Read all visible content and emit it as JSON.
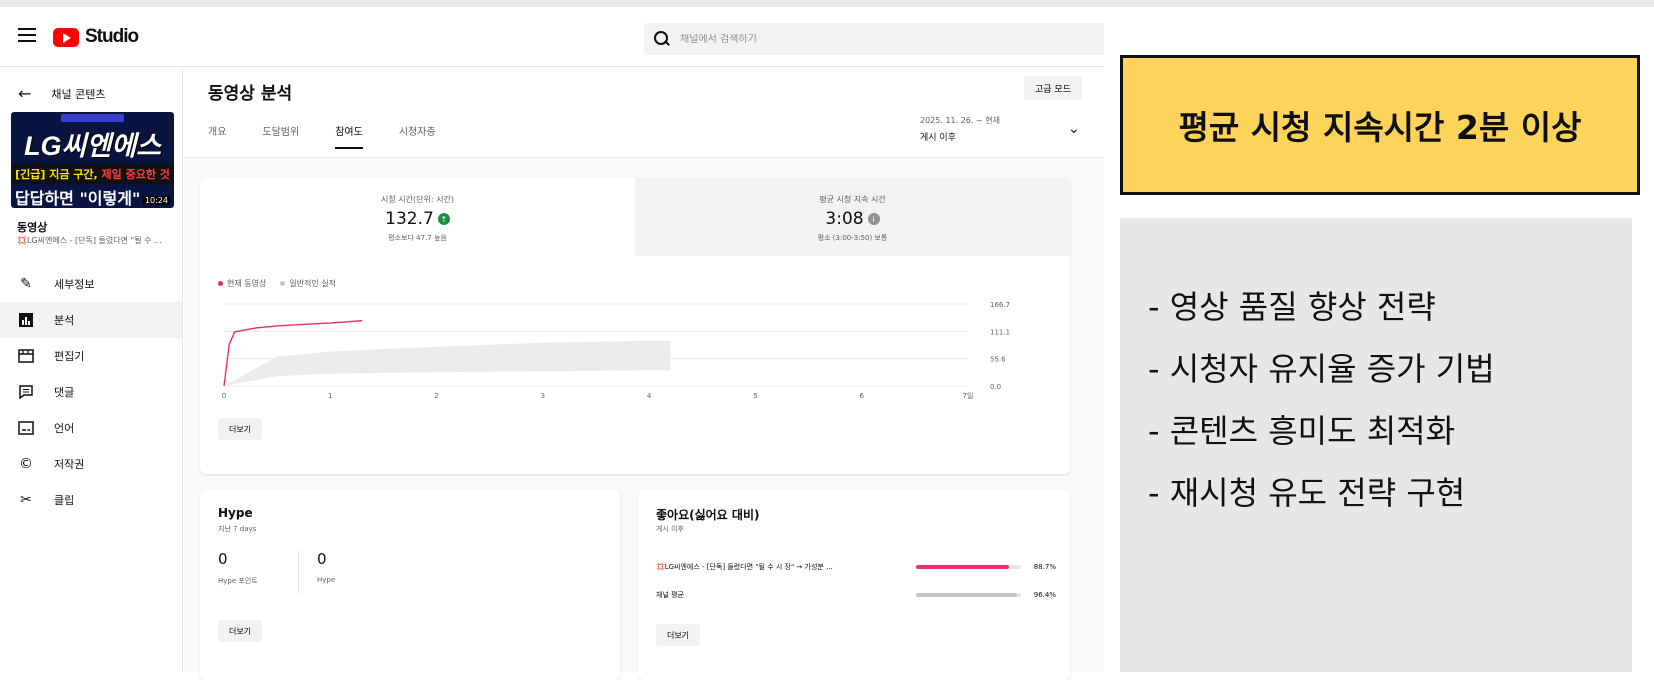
{
  "app": {
    "name": "Studio"
  },
  "search": {
    "placeholder": "채널에서 검색하기"
  },
  "sidebar": {
    "back_label": "채널 콘텐츠",
    "thumb": {
      "title": "LG씨엔에스",
      "line2_highlight": "[긴급]",
      "line2_a": " 지금 구간, ",
      "line2_red": "제일 중요한 것",
      "line3": "답답하면 \"이렇게\"",
      "duration": "10:24"
    },
    "video_label": "동영상",
    "video_title": "💢LG씨엔에스 - [단독] 들렸다면 \"될 수 ...",
    "items": [
      {
        "label": "세부정보",
        "icon": "pencil-icon"
      },
      {
        "label": "분석",
        "icon": "analytics-icon"
      },
      {
        "label": "편집기",
        "icon": "editor-icon"
      },
      {
        "label": "댓글",
        "icon": "comment-icon"
      },
      {
        "label": "언어",
        "icon": "subtitles-icon"
      },
      {
        "label": "저작권",
        "icon": "copyright-icon"
      },
      {
        "label": "클립",
        "icon": "scissors-icon"
      }
    ]
  },
  "header": {
    "title": "동영상 분석",
    "advanced_mode": "고급 모드",
    "tabs": [
      "개요",
      "도달범위",
      "참여도",
      "시청자층"
    ],
    "active_tab": 2,
    "date_range_line1": "2025. 11. 26. ~ 현재",
    "date_range_line2": "게시 이후"
  },
  "metrics": [
    {
      "label": "시청 시간(단위: 시간)",
      "value": "132.7",
      "sub": "평소보다 47.7 높음",
      "status": "up"
    },
    {
      "label": "평균 시청 지속 시간",
      "value": "3:08",
      "sub": "평소 (3:00-3:50) 보통",
      "status": "info"
    }
  ],
  "legend": [
    {
      "label": "현재 동영상",
      "color": "#e8306b"
    },
    {
      "label": "일반적인 실적",
      "color": "#c4c4c4"
    }
  ],
  "chart_data": {
    "type": "line",
    "x_ticks": [
      "0",
      "1",
      "2",
      "3",
      "4",
      "5",
      "6",
      "7일"
    ],
    "y_ticks": [
      "166.7",
      "111.1",
      "55.6",
      "0.0"
    ],
    "ylim": [
      0,
      166.7
    ],
    "xlim": [
      0,
      7
    ],
    "series": [
      {
        "name": "현재 동영상",
        "color": "#e8306b",
        "x": [
          0,
          0.05,
          0.1,
          0.3,
          0.5,
          0.8,
          1.0,
          1.3
        ],
        "y": [
          0,
          85,
          110,
          118,
          122,
          126,
          128,
          132.7
        ]
      }
    ],
    "typical_band": {
      "x": [
        0,
        0.5,
        1,
        2,
        3,
        4,
        4.2
      ],
      "low": [
        0,
        20,
        25,
        28,
        30,
        32,
        32
      ],
      "high": [
        0,
        60,
        70,
        80,
        88,
        92,
        92
      ]
    },
    "more_label": "더보기"
  },
  "hype": {
    "title": "Hype",
    "subtitle": "지난 7 days",
    "points_value": "0",
    "points_label": "Hype 포인트",
    "hype_value": "0",
    "hype_label": "Hype",
    "more_label": "더보기"
  },
  "likes": {
    "title": "좋아요(싫어요 대비)",
    "subtitle": "게시 이후",
    "rows": [
      {
        "name": "💢LG씨엔에스 - [단독] 들렸다면 \"될 수 시 장\" → 가성분 ...",
        "pct": "88.7%",
        "fraction": 0.887,
        "color": "#e8306b"
      },
      {
        "name": "채널 평균",
        "pct": "96.4%",
        "fraction": 0.964,
        "color": "#c4c4c4"
      }
    ],
    "more_label": "더보기"
  },
  "overlay": {
    "headline": "평균 시청 지속시간 2분 이상",
    "bullets": [
      "- 영상 품질 향상 전략",
      "- 시청자 유지율 증가 기법",
      "- 콘텐츠 흥미도 최적화",
      "- 재시청 유도 전략 구현"
    ]
  }
}
